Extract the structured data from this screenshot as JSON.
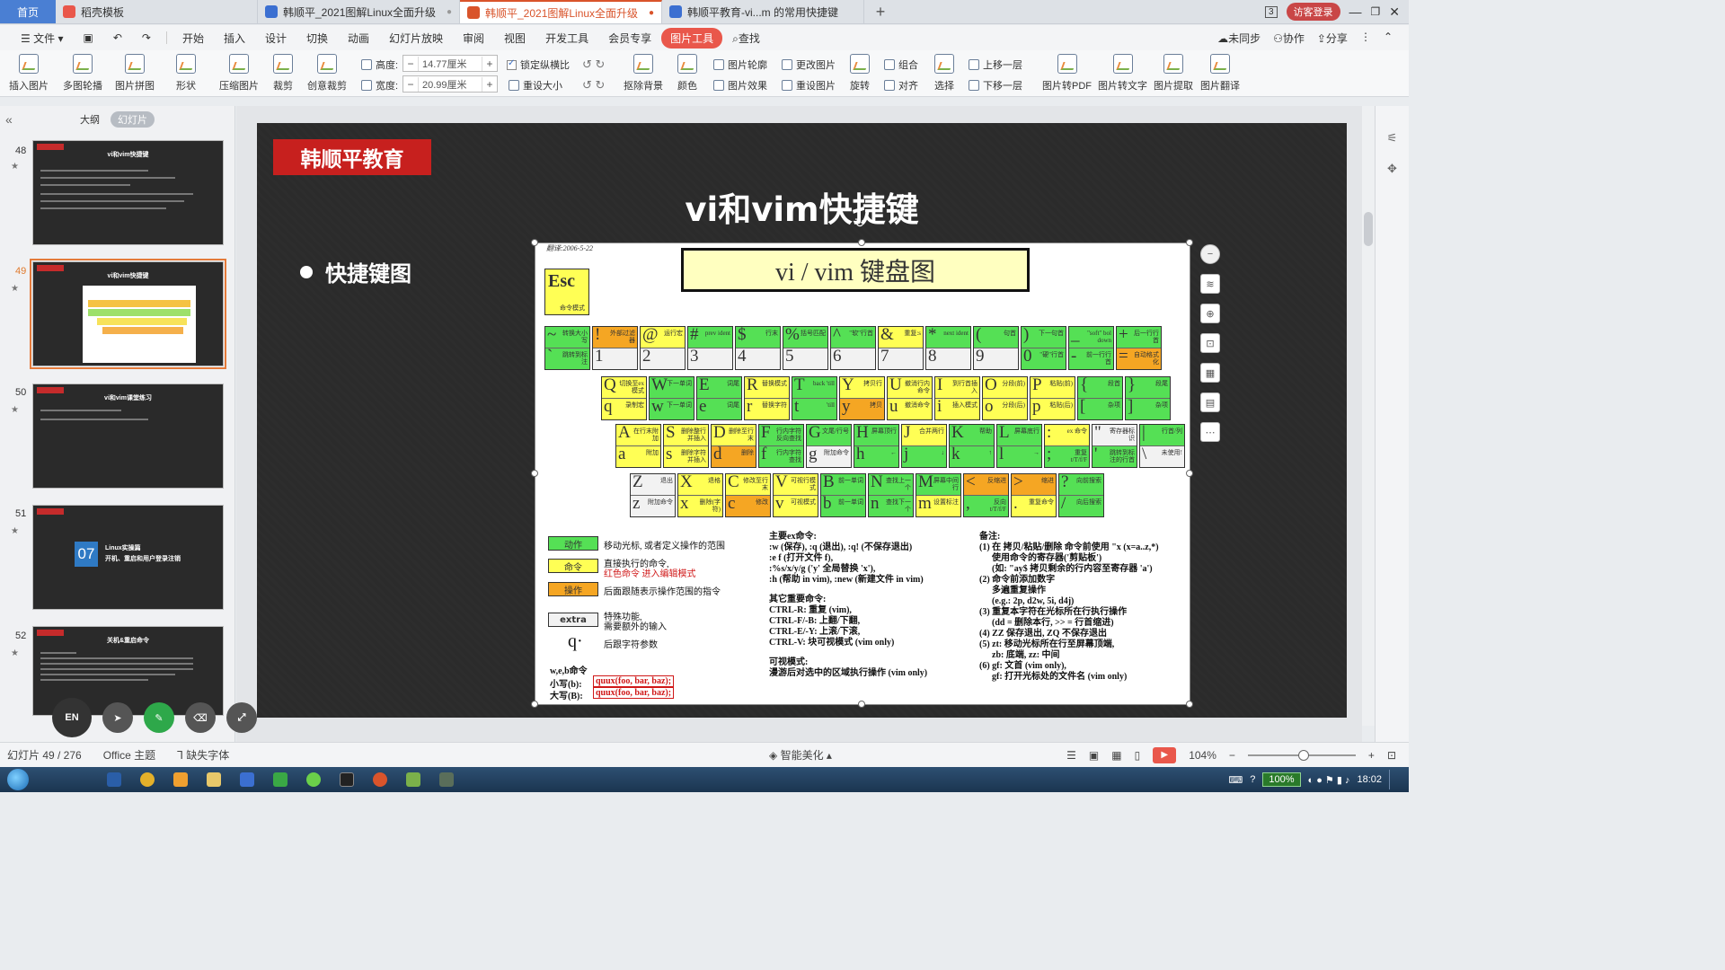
{
  "tabs": {
    "home": "首页",
    "items": [
      {
        "label": "稻壳模板",
        "color": "#e9574b"
      },
      {
        "label": "韩顺平_2021图解Linux全面升级",
        "color": "#3b6fd1"
      },
      {
        "label": "韩顺平_2021图解Linux全面升级",
        "color": "#d9542b"
      },
      {
        "label": "韩顺平教育-vi...m 的常用快捷键",
        "color": "#3b6fd1"
      }
    ],
    "plus": "+",
    "badge": "3",
    "login": "访客登录"
  },
  "menubar": {
    "file": "文件",
    "items": [
      "开始",
      "插入",
      "设计",
      "切换",
      "动画",
      "幻灯片放映",
      "审阅",
      "视图",
      "开发工具",
      "会员专享"
    ],
    "picture_tools": "图片工具",
    "search": "查找",
    "sync": "未同步",
    "collab": "协作",
    "share": "分享"
  },
  "ribbon": {
    "insert_pic": "插入图片",
    "multi_outline": "多图轮播",
    "collage": "图片拼图",
    "shape": "形状",
    "compress": "压缩图片",
    "crop": "裁剪",
    "creative_crop": "创意裁剪",
    "height_label": "高度:",
    "height_value": "14.77厘米",
    "width_label": "宽度:",
    "width_value": "20.99厘米",
    "lock_ratio": "锁定纵横比",
    "reset_size": "重设大小",
    "remove_bg": "抠除背景",
    "color": "颜色",
    "pic_outline": "图片轮廓",
    "pic_effect": "图片效果",
    "change_pic": "更改图片",
    "reset_pic": "重设图片",
    "rotate": "旋转",
    "group": "组合",
    "align": "对齐",
    "select": "选择",
    "bring_forward": "上移一层",
    "send_backward": "下移一层",
    "to_pdf": "图片转PDF",
    "to_text": "图片转文字",
    "extract": "图片提取",
    "translate": "图片翻译"
  },
  "left_panel": {
    "collapse": "«",
    "outline": "大纲",
    "slides": "幻灯片",
    "thumbs": [
      {
        "num": "48",
        "title": "vi和vim快捷键"
      },
      {
        "num": "49",
        "title": "vi和vim快捷键"
      },
      {
        "num": "50",
        "title": "vi和vim课堂练习"
      },
      {
        "num": "51",
        "title": "开机、重启和用户登录注销",
        "chapter": "07",
        "chapter_title": "Linux实操篇"
      },
      {
        "num": "52",
        "title": "关机&重启命令"
      }
    ]
  },
  "slide": {
    "brand": "韩顺平教育",
    "title": "vi和vim快捷键",
    "bullet": "快捷键图"
  },
  "keyboard": {
    "date": "翻译:2006-5-22",
    "title": "vi / vim 键盘图",
    "esc": {
      "key": "Esc",
      "desc": "命令模式"
    },
    "row1": [
      {
        "u": "~",
        "ud": "转换大小写",
        "uc": "g",
        "d": "`",
        "dd": "跳转到标注",
        "dc": "g"
      },
      {
        "u": "!",
        "ud": "外部过滤器",
        "uc": "o",
        "d": "1",
        "dd": "",
        "dc": "w"
      },
      {
        "u": "@",
        "ud": "运行宏",
        "uc": "y",
        "d": "2",
        "dd": "",
        "dc": "w"
      },
      {
        "u": "#",
        "ud": "prev ident",
        "uc": "g",
        "d": "3",
        "dd": "",
        "dc": "w"
      },
      {
        "u": "$",
        "ud": "行末",
        "uc": "g",
        "d": "4",
        "dd": "",
        "dc": "w"
      },
      {
        "u": "%",
        "ud": "括号匹配",
        "uc": "g",
        "d": "5",
        "dd": "",
        "dc": "w"
      },
      {
        "u": "^",
        "ud": "\"软\"行首",
        "uc": "g",
        "d": "6",
        "dd": "",
        "dc": "w"
      },
      {
        "u": "&",
        "ud": "重复:s",
        "uc": "y",
        "d": "7",
        "dd": "",
        "dc": "w"
      },
      {
        "u": "*",
        "ud": "next ident",
        "uc": "g",
        "d": "8",
        "dd": "",
        "dc": "w"
      },
      {
        "u": "(",
        "ud": "句首",
        "uc": "g",
        "d": "9",
        "dd": "",
        "dc": "w"
      },
      {
        "u": ")",
        "ud": "下一句首",
        "uc": "g",
        "d": "0",
        "dd": "\"硬\"行首",
        "dc": "g"
      },
      {
        "u": "_",
        "ud": "\"soft\" bol down",
        "uc": "g",
        "d": "-",
        "dd": "前一行行首",
        "dc": "g"
      },
      {
        "u": "+",
        "ud": "后一行行首",
        "uc": "g",
        "d": "=",
        "dd": "自动格式化",
        "dc": "o"
      }
    ],
    "row2": [
      {
        "u": "Q",
        "ud": "切换至ex模式",
        "uc": "y",
        "d": "q",
        "dd": "录制宏",
        "dc": "y"
      },
      {
        "u": "W",
        "ud": "下一单词",
        "uc": "g",
        "d": "w",
        "dd": "下一单词",
        "dc": "g"
      },
      {
        "u": "E",
        "ud": "词尾",
        "uc": "g",
        "d": "e",
        "dd": "词尾",
        "dc": "g"
      },
      {
        "u": "R",
        "ud": "替换模式",
        "uc": "y",
        "d": "r",
        "dd": "替换字符",
        "dc": "y"
      },
      {
        "u": "T",
        "ud": "back 'till",
        "uc": "g",
        "d": "t",
        "dd": "'till",
        "dc": "g"
      },
      {
        "u": "Y",
        "ud": "拷贝行",
        "uc": "y",
        "d": "y",
        "dd": "拷贝",
        "dc": "o"
      },
      {
        "u": "U",
        "ud": "撤消行内命令",
        "uc": "y",
        "d": "u",
        "dd": "撤消命令",
        "dc": "y"
      },
      {
        "u": "I",
        "ud": "到行首插入",
        "uc": "y",
        "d": "i",
        "dd": "插入模式",
        "dc": "y"
      },
      {
        "u": "O",
        "ud": "分段(前)",
        "uc": "y",
        "d": "o",
        "dd": "分段(后)",
        "dc": "y"
      },
      {
        "u": "P",
        "ud": "粘贴(前)",
        "uc": "y",
        "d": "p",
        "dd": "粘贴(后)",
        "dc": "y"
      },
      {
        "u": "{",
        "ud": "段首",
        "uc": "g",
        "d": "[",
        "dd": "杂项",
        "dc": "g"
      },
      {
        "u": "}",
        "ud": "段尾",
        "uc": "g",
        "d": "]",
        "dd": "杂项",
        "dc": "g"
      }
    ],
    "row3": [
      {
        "u": "A",
        "ud": "在行末附加",
        "uc": "y",
        "d": "a",
        "dd": "附加",
        "dc": "y"
      },
      {
        "u": "S",
        "ud": "删除整行并插入",
        "uc": "y",
        "d": "s",
        "dd": "删除字符并插入",
        "dc": "y"
      },
      {
        "u": "D",
        "ud": "删除至行末",
        "uc": "y",
        "d": "d",
        "dd": "删除",
        "dc": "o"
      },
      {
        "u": "F",
        "ud": "行内字符反向查找",
        "uc": "g",
        "d": "f",
        "dd": "行内字符查找",
        "dc": "g"
      },
      {
        "u": "G",
        "ud": "文尾/行号",
        "uc": "g",
        "d": "g",
        "dd": "附加命令",
        "dc": "w"
      },
      {
        "u": "H",
        "ud": "屏幕顶行",
        "uc": "g",
        "d": "h",
        "dd": "←",
        "dc": "g"
      },
      {
        "u": "J",
        "ud": "合并两行",
        "uc": "y",
        "d": "j",
        "dd": "↓",
        "dc": "g"
      },
      {
        "u": "K",
        "ud": "帮助",
        "uc": "g",
        "d": "k",
        "dd": "↑",
        "dc": "g"
      },
      {
        "u": "L",
        "ud": "屏幕底行",
        "uc": "g",
        "d": "l",
        "dd": "→",
        "dc": "g"
      },
      {
        "u": ":",
        "ud": "ex 命令",
        "uc": "y",
        "d": ";",
        "dd": "重复 t/T/f/F",
        "dc": "g"
      },
      {
        "u": "\"",
        "ud": "寄存器标识",
        "uc": "w",
        "d": "'",
        "dd": "跳转到标注的行首",
        "dc": "g"
      },
      {
        "u": "|",
        "ud": "行首/列",
        "uc": "g",
        "d": "\\",
        "dd": "未使用!",
        "dc": "w"
      }
    ],
    "row4": [
      {
        "u": "Z",
        "ud": "退出",
        "uc": "w",
        "d": "z",
        "dd": "附加命令",
        "dc": "w"
      },
      {
        "u": "X",
        "ud": "退格",
        "uc": "y",
        "d": "x",
        "dd": "删除(字符)",
        "dc": "y"
      },
      {
        "u": "C",
        "ud": "修改至行末",
        "uc": "y",
        "d": "c",
        "dd": "修改",
        "dc": "o"
      },
      {
        "u": "V",
        "ud": "可视行模式",
        "uc": "y",
        "d": "v",
        "dd": "可视模式",
        "dc": "y"
      },
      {
        "u": "B",
        "ud": "前一单词",
        "uc": "g",
        "d": "b",
        "dd": "前一单词",
        "dc": "g"
      },
      {
        "u": "N",
        "ud": "查找上一个",
        "uc": "g",
        "d": "n",
        "dd": "查找下一个",
        "dc": "g"
      },
      {
        "u": "M",
        "ud": "屏幕中间行",
        "uc": "g",
        "d": "m",
        "dd": "设置标注",
        "dc": "y"
      },
      {
        "u": "<",
        "ud": "反缩进",
        "uc": "o",
        "d": ",",
        "dd": "反向 t/T/f/F",
        "dc": "g"
      },
      {
        "u": ">",
        "ud": "缩进",
        "uc": "o",
        "d": ".",
        "dd": "重复命令",
        "dc": "y"
      },
      {
        "u": "?",
        "ud": "向前搜索",
        "uc": "g",
        "d": "/",
        "dd": "向后搜索",
        "dc": "g"
      }
    ],
    "legend": {
      "motion": "动作",
      "motion_desc": "移动光标, 或者定义操作的范围",
      "command": "命令",
      "command_desc1": "直接执行的命令,",
      "command_desc2": "红色命令 进入编辑模式",
      "operator": "操作",
      "operator_desc": "后面跟随表示操作范围的指令",
      "extra": "extra",
      "extra_desc1": "特殊功能,",
      "extra_desc2": "需要额外的输入",
      "q": "q·",
      "q_desc": "后跟字符参数",
      "web_title": "w,e,b命令",
      "web_lower": "小写(b):",
      "web_upper": "大写(B):",
      "web_example": "quux(foo, bar, baz);"
    },
    "ex_cmds": {
      "title": "主要ex命令:",
      "lines": [
        ":w (保存), :q (退出), :q! (不保存退出)",
        ":e f (打开文件 f),",
        ":%s/x/y/g ('y' 全局替换 'x'),",
        ":h (帮助 in vim), :new (新建文件 in vim)"
      ],
      "other_title": "其它重要命令:",
      "other_lines": [
        "CTRL-R: 重复 (vim),",
        "CTRL-F/-B: 上翻/下翻,",
        "CTRL-E/-Y: 上滚/下滚,",
        "CTRL-V: 块可视模式 (vim only)"
      ],
      "visual_title": "可视模式:",
      "visual_line": "漫游后对选中的区域执行操作 (vim only)"
    },
    "notes": {
      "title": "备注:",
      "lines": [
        "(1) 在 拷贝/粘贴/删除 命令前使用 \"x (x=a..z,*)",
        "使用命令的寄存器('剪贴板')",
        "(如: \"ay$ 拷贝剩余的行内容至寄存器 'a')",
        "(2) 命令前添加数字",
        "多遍重复操作",
        "(e.g.: 2p, d2w, 5i, d4j)",
        "(3) 重复本字符在光标所在行执行操作",
        "(dd = 删除本行, >> = 行首缩进)",
        "(4) ZZ 保存退出, ZQ 不保存退出",
        "(5) zt: 移动光标所在行至屏幕顶端,",
        "zb: 底端, zz: 中间",
        "(6) gf: 文首 (vim only),",
        "gf: 打开光标处的文件名 (vim only)"
      ]
    }
  },
  "float_tools": {
    "en": "EN"
  },
  "status": {
    "slide_info": "幻灯片 49 / 276",
    "theme": "Office 主题",
    "missing_font": "缺失字体",
    "beautify": "智能美化",
    "zoom": "104%"
  },
  "taskbar": {
    "battery": "100%",
    "time": "18:02"
  },
  "colors": {
    "accent": "#e9574b",
    "brand_red": "#c7201e",
    "selected_thumb": "#e47a3a"
  }
}
